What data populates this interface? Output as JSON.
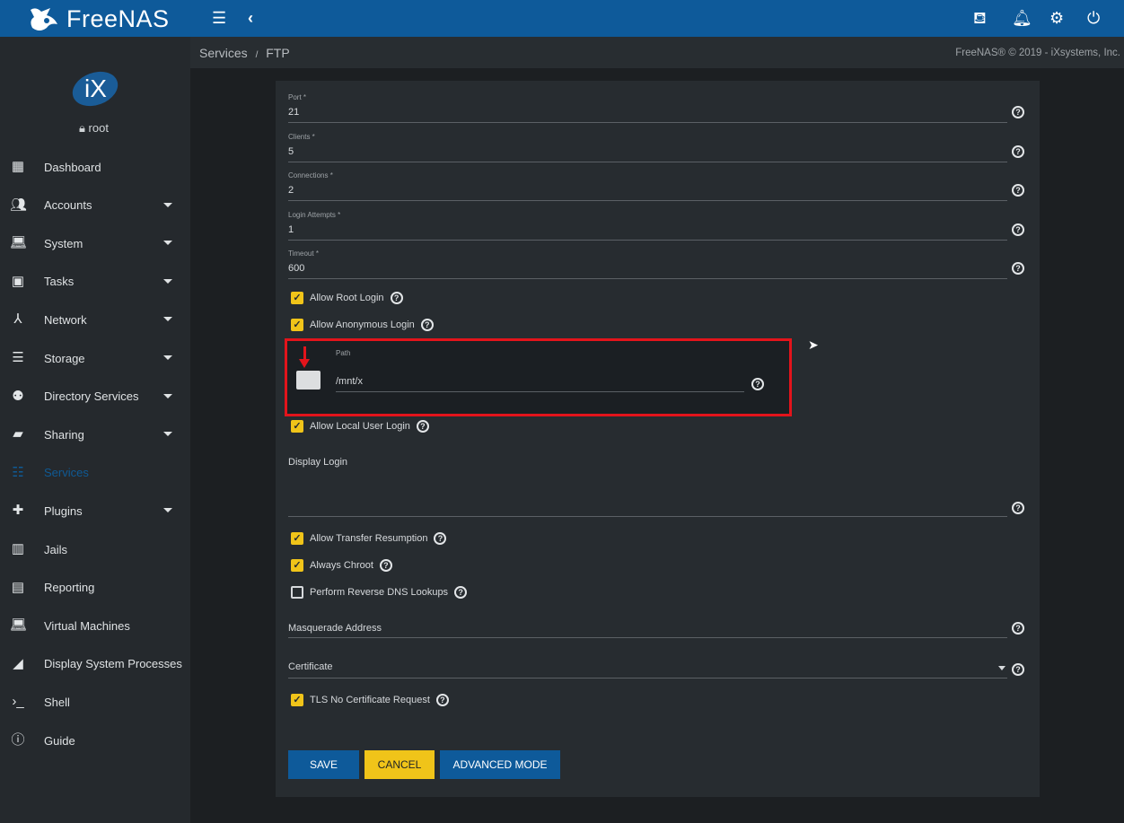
{
  "header": {
    "brand": "FreeNAS",
    "icons": [
      "menu-icon",
      "chevron-left-icon",
      "theme-icon",
      "bell-icon",
      "gear-icon",
      "power-icon"
    ]
  },
  "sidebar": {
    "logo": "iX",
    "user": "root",
    "items": [
      {
        "label": "Dashboard",
        "icon": "dashboard-icon",
        "caret": false
      },
      {
        "label": "Accounts",
        "icon": "people-icon",
        "caret": true
      },
      {
        "label": "System",
        "icon": "laptop-icon",
        "caret": true
      },
      {
        "label": "Tasks",
        "icon": "calendar-icon",
        "caret": true
      },
      {
        "label": "Network",
        "icon": "network-icon",
        "caret": true
      },
      {
        "label": "Storage",
        "icon": "storage-icon",
        "caret": true
      },
      {
        "label": "Directory Services",
        "icon": "directory-icon",
        "caret": true
      },
      {
        "label": "Sharing",
        "icon": "folder-shared-icon",
        "caret": true
      },
      {
        "label": "Services",
        "icon": "tune-icon",
        "caret": false,
        "active": true
      },
      {
        "label": "Plugins",
        "icon": "puzzle-icon",
        "caret": true
      },
      {
        "label": "Jails",
        "icon": "jail-icon",
        "caret": false
      },
      {
        "label": "Reporting",
        "icon": "chart-icon",
        "caret": false
      },
      {
        "label": "Virtual Machines",
        "icon": "laptop-icon",
        "caret": false
      },
      {
        "label": "Display System Processes",
        "icon": "processes-icon",
        "caret": false
      },
      {
        "label": "Shell",
        "icon": "terminal-icon",
        "caret": false
      },
      {
        "label": "Guide",
        "icon": "info-icon",
        "caret": false
      }
    ]
  },
  "breadcrumb": {
    "parent": "Services",
    "sep": "/",
    "current": "FTP"
  },
  "copyright": "FreeNAS® © 2019 - iXsystems, Inc.",
  "form": {
    "fields": [
      {
        "label": "Port *",
        "value": "21"
      },
      {
        "label": "Clients *",
        "value": "5"
      },
      {
        "label": "Connections *",
        "value": "2"
      },
      {
        "label": "Login Attempts *",
        "value": "1"
      },
      {
        "label": "Timeout *",
        "value": "600"
      }
    ],
    "allow_root": {
      "label": "Allow Root Login",
      "checked": true
    },
    "allow_anon": {
      "label": "Allow Anonymous Login",
      "checked": true
    },
    "path": {
      "label": "Path",
      "value": "/mnt/x"
    },
    "allow_local": {
      "label": "Allow Local User Login",
      "checked": true
    },
    "display_login": {
      "label": "Display Login",
      "value": ""
    },
    "resume": {
      "label": "Allow Transfer Resumption",
      "checked": true
    },
    "chroot": {
      "label": "Always Chroot",
      "checked": true
    },
    "reverse_dns": {
      "label": "Perform Reverse DNS Lookups",
      "checked": false
    },
    "masquerade": {
      "label": "Masquerade Address",
      "value": ""
    },
    "certificate": {
      "label": "Certificate",
      "value": ""
    },
    "tls_nocert": {
      "label": "TLS No Certificate Request",
      "checked": true
    },
    "buttons": {
      "save": "SAVE",
      "cancel": "CANCEL",
      "advanced": "ADVANCED MODE"
    }
  },
  "colors": {
    "topbar": "#0e5a9a",
    "accent": "#f0c419",
    "primary": "#0f5a95",
    "highlight": "#e3141b"
  }
}
